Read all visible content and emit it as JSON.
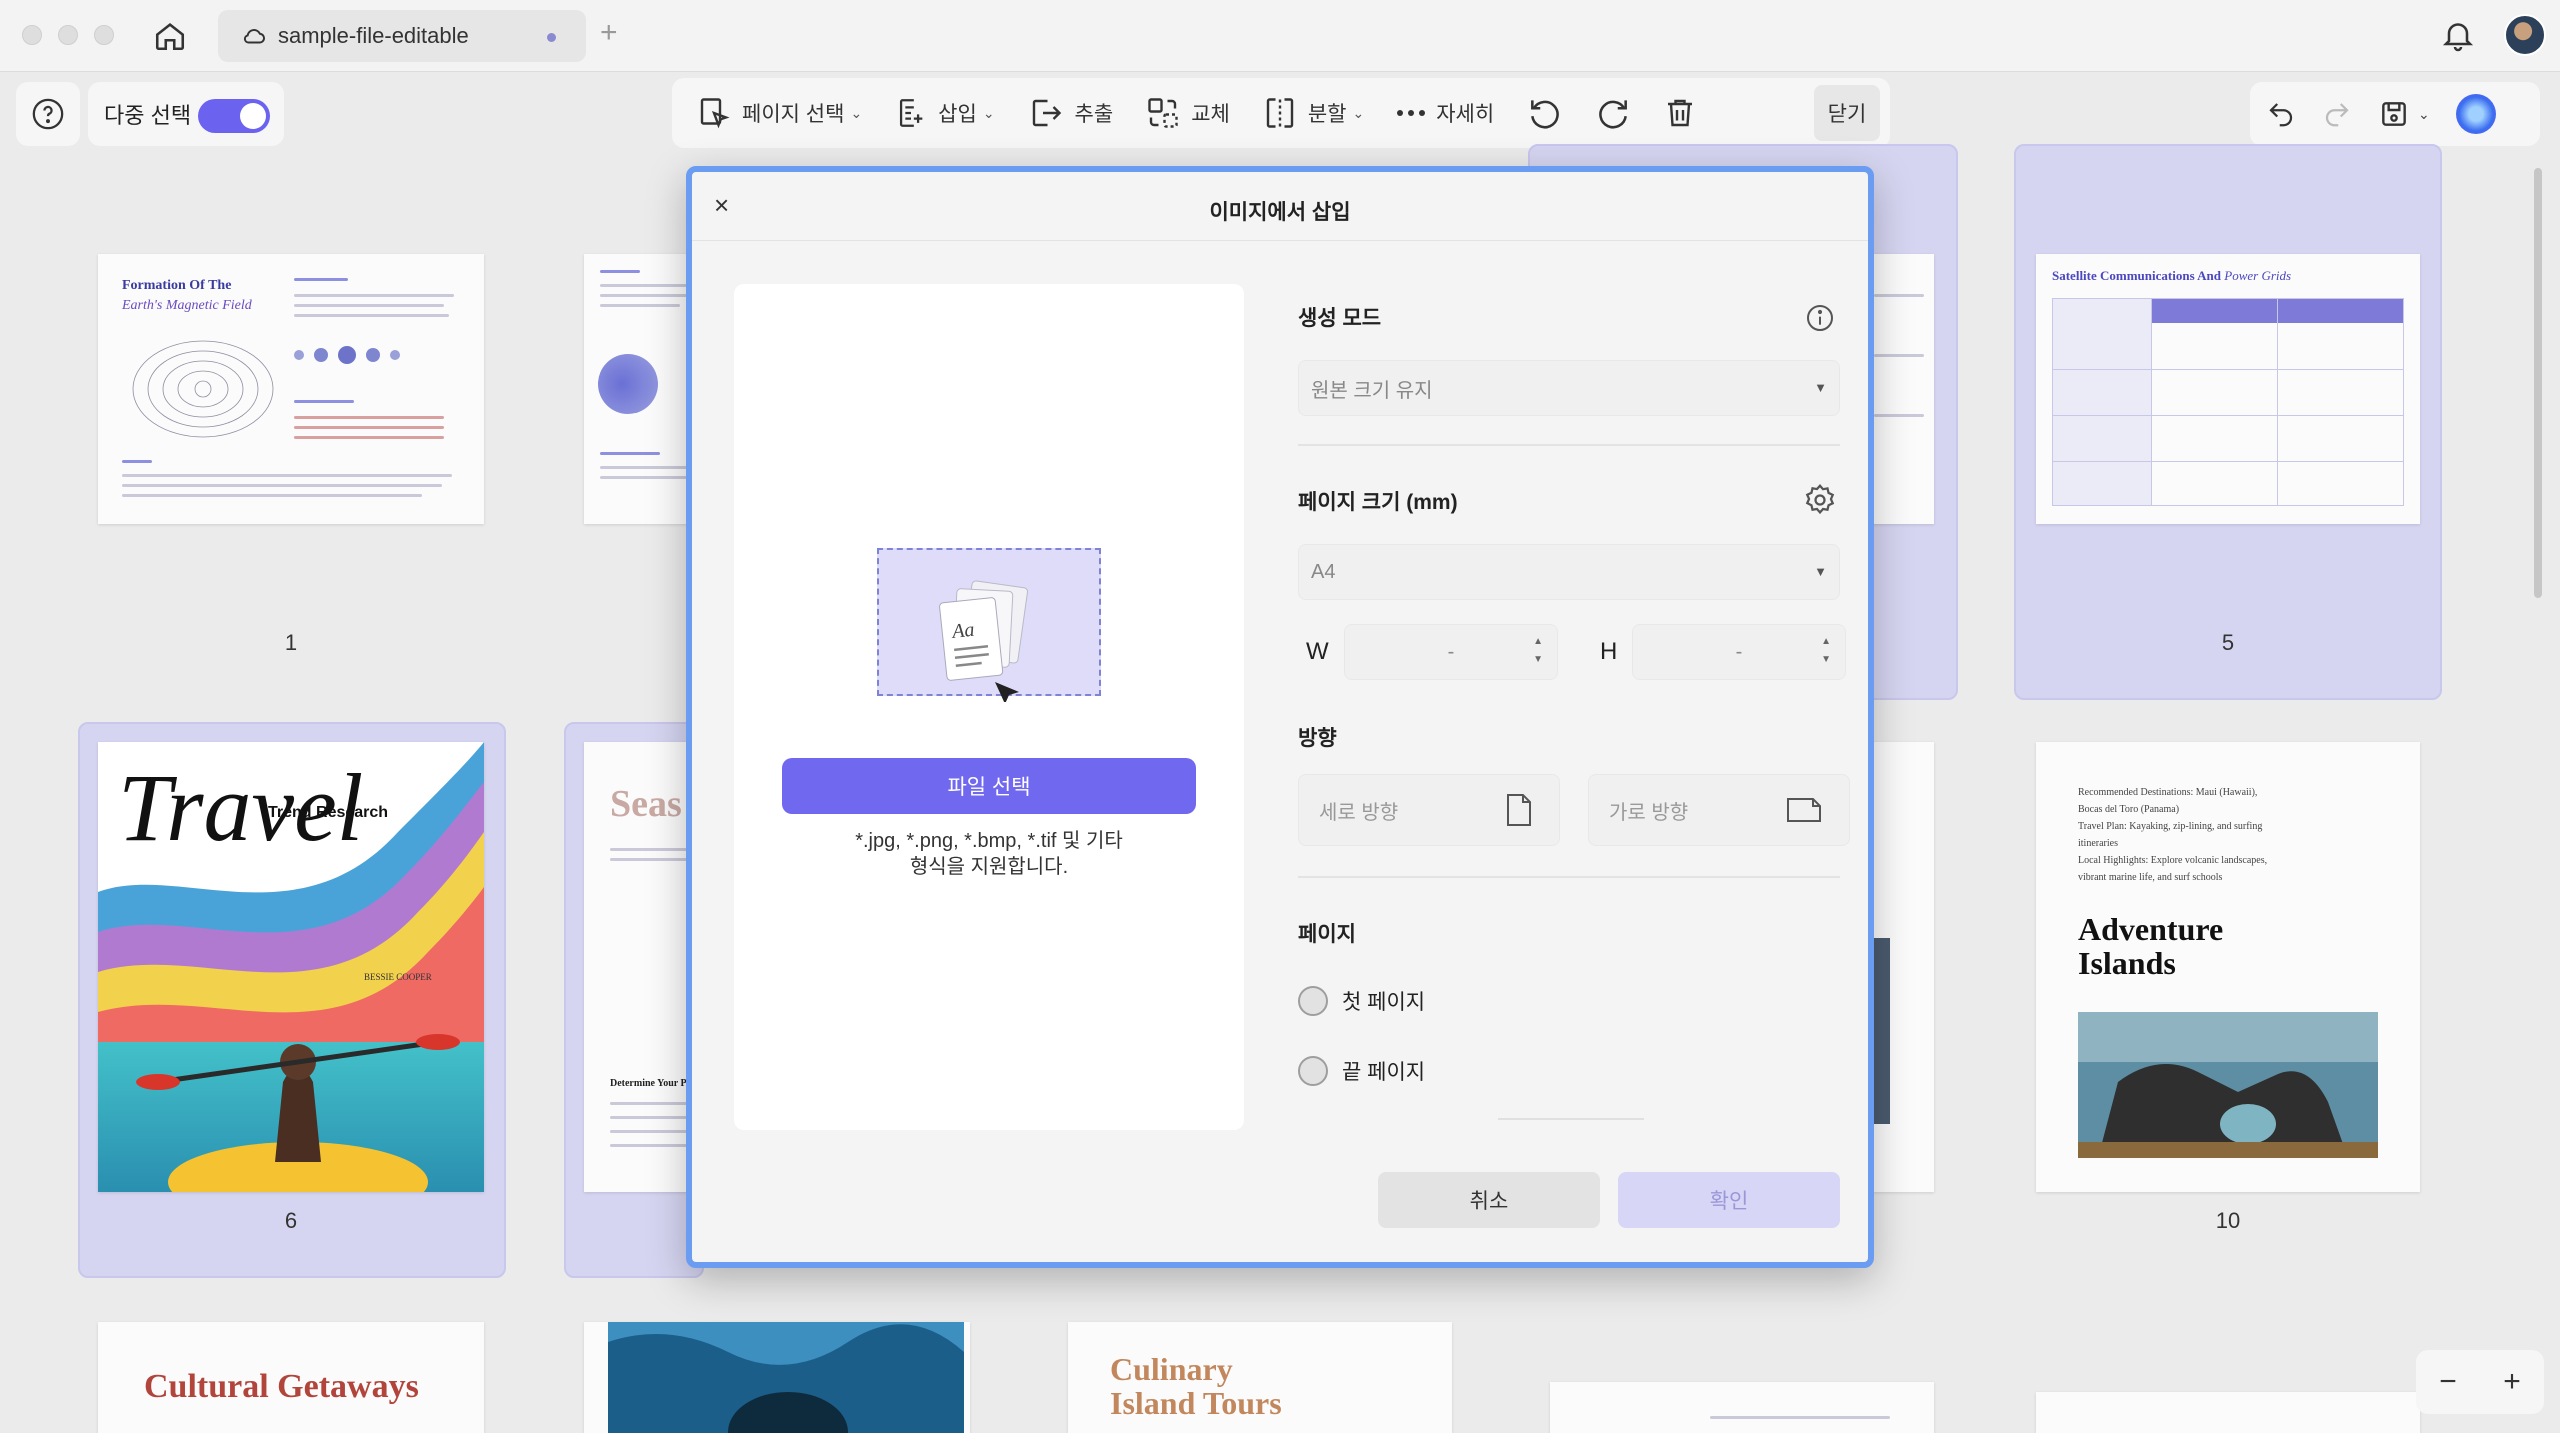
{
  "titlebar": {
    "tab_title": "sample-file-editable",
    "new_tab": "+"
  },
  "toolbar": {
    "help": "?",
    "multi_select_label": "다중 선택",
    "multi_select_on": true,
    "page_select": "페이지 선택",
    "insert": "삽입",
    "extract": "추출",
    "replace": "교체",
    "split": "분할",
    "more": "자세히",
    "close": "닫기"
  },
  "pages": {
    "p1": {
      "number": "1",
      "title_line1": "Formation Of The",
      "title_line2": "Earth's Magnetic Field"
    },
    "p5": {
      "number": "5",
      "title": "Satellite Communications And",
      "title_italic": "Power Grids"
    },
    "p6": {
      "number": "6",
      "script_title": "Travel",
      "subtitle": "Trend Research",
      "author": "BESSIE COOPER"
    },
    "p7": {
      "title": "Seas",
      "heading": "Determine Your P"
    },
    "p10": {
      "number": "10",
      "intro_lines": [
        "Recommended Destinations: Maui (Hawaii),",
        "Bocas del Toro (Panama)",
        "Travel Plan: Kayaking, zip-lining, and surfing",
        "itineraries",
        "Local Highlights: Explore volcanic landscapes,",
        "vibrant marine life, and surf schools"
      ],
      "title": "Adventure Islands"
    },
    "p11": {
      "title": "Cultural Getaways"
    },
    "p13": {
      "title_line1": "Culinary",
      "title_line2": "Island Tours"
    }
  },
  "modal": {
    "close": "×",
    "title": "이미지에서 삽입",
    "file_button": "파일 선택",
    "formats_line1": "*.jpg, *.png, *.bmp, *.tif 및 기타",
    "formats_line2": "형식을 지원합니다.",
    "mode_label": "생성 모드",
    "mode_value": "원본 크기 유지",
    "page_size_label": "페이지 크기 (mm)",
    "page_size_value": "A4",
    "w_label": "W",
    "w_value": "-",
    "h_label": "H",
    "h_value": "-",
    "orientation_label": "방향",
    "portrait": "세로 방향",
    "landscape": "가로 방향",
    "page_label": "페이지",
    "first_page": "첫 페이지",
    "last_page": "끝 페이지",
    "cancel": "취소",
    "confirm": "확인"
  },
  "zoom": {
    "minus": "−",
    "plus": "+"
  },
  "colors": {
    "accent": "#6b63f0",
    "modal_border": "#6a9cf2",
    "selection": "#d6d5f1"
  }
}
